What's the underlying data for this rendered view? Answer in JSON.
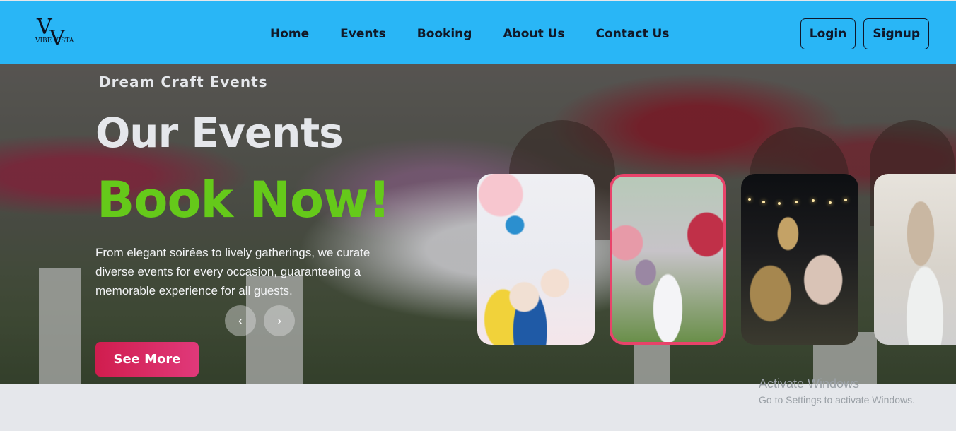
{
  "brand": {
    "logo_text": "VIBE VISTA",
    "logo_mark": "VV"
  },
  "nav": {
    "links": [
      "Home",
      "Events",
      "Booking",
      "About Us",
      "Contact Us"
    ],
    "login_label": "Login",
    "signup_label": "Signup"
  },
  "hero": {
    "tagline": "Dream Craft Events",
    "title": "Our Events",
    "cta_title": "Book Now!",
    "description": "From elegant soirées to lively gatherings, we curate diverse events for every occasion, guaranteeing a memorable experience for all guests.",
    "prev_icon": "‹",
    "next_icon": "›",
    "see_more_label": "See More"
  },
  "cards": [
    {
      "name": "birthday-party-card",
      "active": false
    },
    {
      "name": "wedding-arch-card",
      "active": true
    },
    {
      "name": "night-wedding-card",
      "active": false
    },
    {
      "name": "table-setting-card",
      "active": false
    }
  ],
  "watermark": {
    "title": "Activate Windows",
    "subtitle": "Go to Settings to activate Windows."
  },
  "colors": {
    "navbar": "#29b6f6",
    "accent_green": "#65c91a",
    "cta_pink": "#d01d4e",
    "active_border": "#e8436a"
  }
}
